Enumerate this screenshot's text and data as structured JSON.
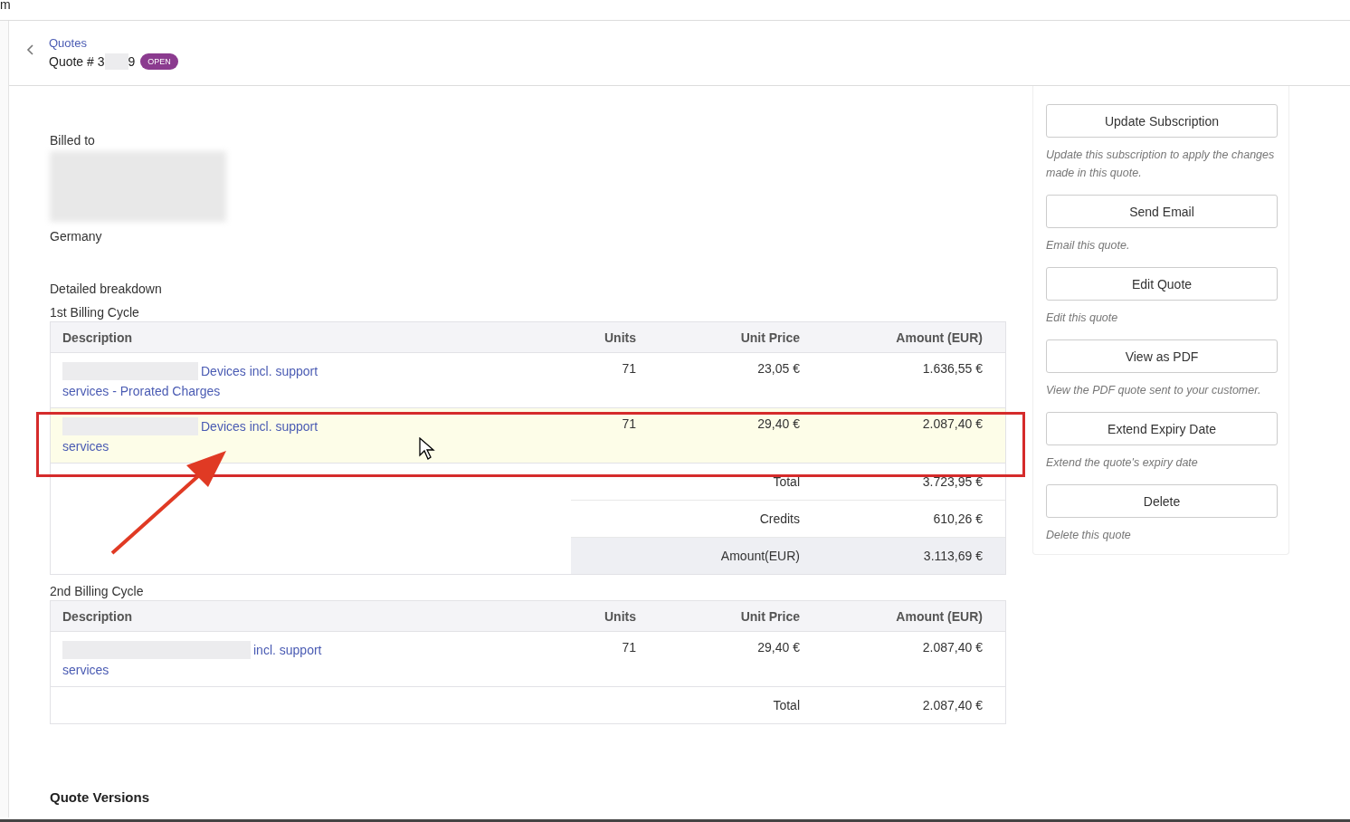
{
  "top_bar": {
    "text": "m"
  },
  "header": {
    "breadcrumb": "Quotes",
    "title_start": "Quote # 3",
    "title_end": "9",
    "status": "OPEN"
  },
  "billed_to": {
    "label": "Billed to",
    "country": "Germany"
  },
  "breakdown": {
    "title": "Detailed breakdown",
    "cycles": [
      {
        "title": "1st Billing Cycle",
        "columns": [
          "Description",
          "Units",
          "Unit Price",
          "Amount (EUR)"
        ],
        "rows": [
          {
            "description": [
              "Devices incl. support",
              "services - Prorated Charges"
            ],
            "units": "71",
            "unit_price": "23,05 €",
            "amount": "1.636,55 €",
            "highlighted": false
          },
          {
            "description": [
              "Devices incl. support",
              "services"
            ],
            "units": "71",
            "unit_price": "29,40 €",
            "amount": "2.087,40 €",
            "highlighted": true
          }
        ],
        "summary": [
          {
            "label": "Total",
            "value": "3.723,95 €",
            "shaded": false
          },
          {
            "label": "Credits",
            "value": "610,26 €",
            "shaded": false
          },
          {
            "label": "Amount(EUR)",
            "value": "3.113,69 €",
            "shaded": true
          }
        ]
      },
      {
        "title": "2nd Billing Cycle",
        "columns": [
          "Description",
          "Units",
          "Unit Price",
          "Amount (EUR)"
        ],
        "rows": [
          {
            "description": [
              "incl. support",
              "services"
            ],
            "units": "71",
            "unit_price": "29,40 €",
            "amount": "2.087,40 €",
            "highlighted": false
          }
        ],
        "summary": [
          {
            "label": "Total",
            "value": "2.087,40 €",
            "shaded": false
          }
        ]
      }
    ]
  },
  "versions": {
    "title": "Quote Versions"
  },
  "actions": [
    {
      "label": "Update Subscription",
      "hint": "Update this subscription to apply the changes made in this quote."
    },
    {
      "label": "Send Email",
      "hint": "Email this quote."
    },
    {
      "label": "Edit Quote",
      "hint": "Edit this quote"
    },
    {
      "label": "View as PDF",
      "hint": "View the PDF quote sent to your customer."
    },
    {
      "label": "Extend Expiry Date",
      "hint": "Extend the quote's expiry date"
    },
    {
      "label": "Delete",
      "hint": "Delete this quote"
    }
  ]
}
